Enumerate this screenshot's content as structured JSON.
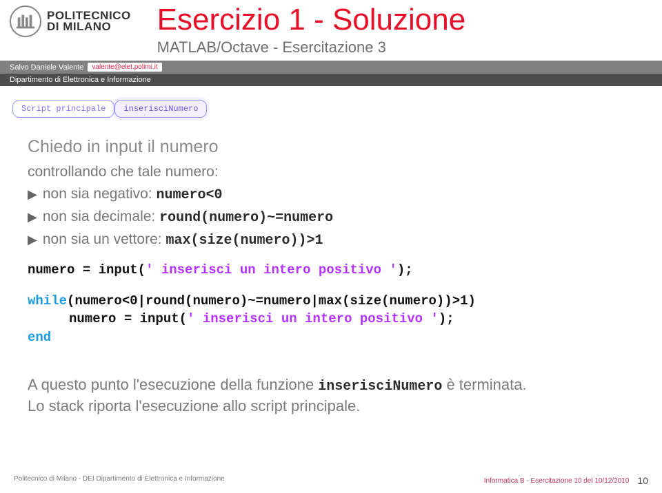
{
  "header": {
    "institution_line1": "POLITECNICO",
    "institution_line2": "DI MILANO",
    "title": "Esercizio 1 - Soluzione",
    "subtitle": "MATLAB/Octave - Esercitazione 3"
  },
  "author": {
    "name": "Salvo Daniele Valente",
    "email": "valente@elet.polimi.it",
    "department": "Dipartimento di Elettronica e Informazione"
  },
  "tabs": {
    "main": "Script principale",
    "fn": "inserisciNumero"
  },
  "body": {
    "lead": "Chiedo in input il numero",
    "subhead": "controllando che tale numero:",
    "bullets": [
      {
        "text": "non sia negativo: ",
        "code": "numero<0"
      },
      {
        "text": "non sia decimale: ",
        "code": "round(numero)~=numero"
      },
      {
        "text": "non sia un vettore: ",
        "code": "max(size(numero))>1"
      }
    ],
    "code": {
      "l1a": "numero = input(",
      "l1b": "' inserisci un intero positivo '",
      "l1c": ");",
      "l2a": "while",
      "l2b": "(numero<0|round(numero)~=numero|max(size(numero))>1)",
      "l3a": "numero = input(",
      "l3b": "' inserisci un intero positivo '",
      "l3c": ");",
      "l4": "end"
    },
    "closing_a": "A questo punto l'esecuzione della funzione ",
    "closing_code": "inserisciNumero",
    "closing_b": " è terminata.",
    "closing_c": "Lo stack riporta l'esecuzione allo script principale."
  },
  "footer": {
    "left": "Politecnico di Milano - DEI Dipartimento di Elettronica e Informazione",
    "right": "Informatica B - Esercitazione 10 del 10/12/2010",
    "page": "10"
  }
}
